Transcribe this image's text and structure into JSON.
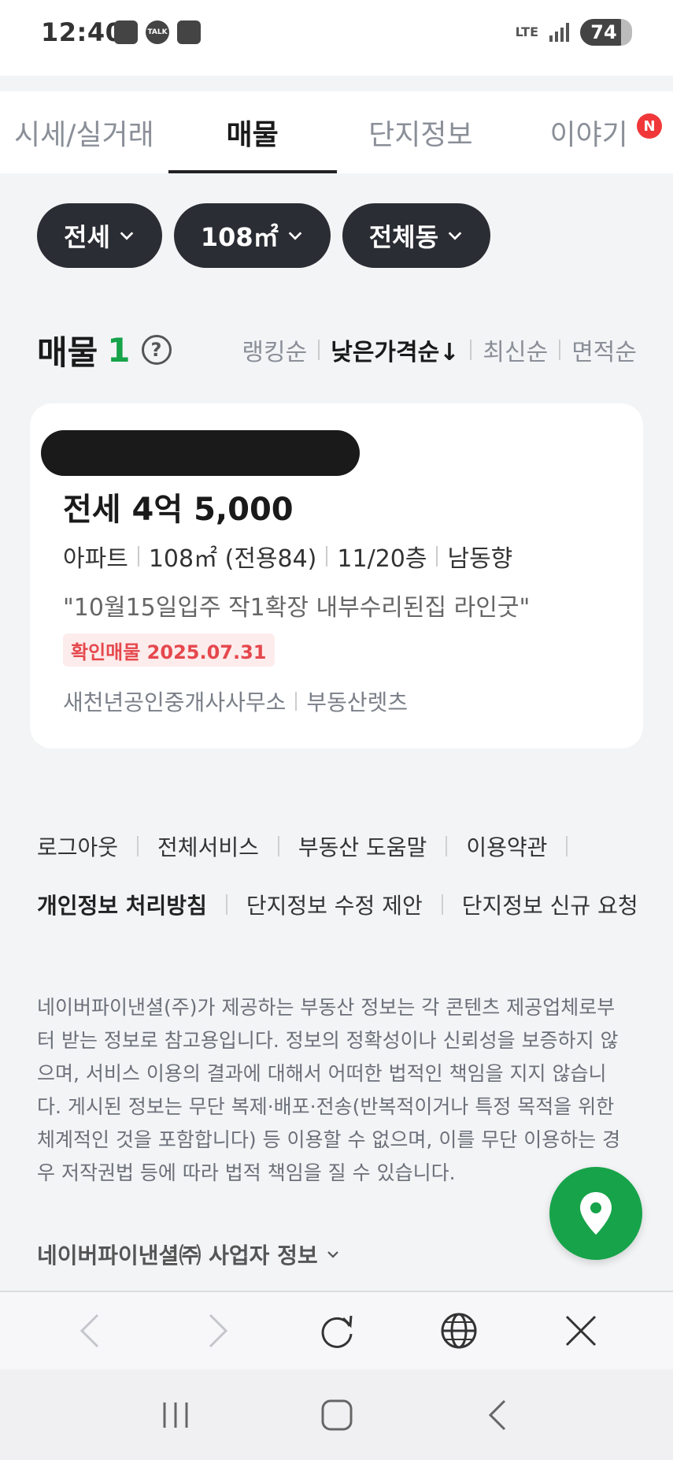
{
  "status_bar": {
    "time": "12:40",
    "network": "LTE",
    "battery": "74",
    "talk_icon": "TALK"
  },
  "tabs": [
    {
      "label": "시세/실거래",
      "active": false
    },
    {
      "label": "매물",
      "active": true
    },
    {
      "label": "단지정보",
      "active": false
    },
    {
      "label": "이야기",
      "active": false,
      "badge": "N"
    }
  ],
  "filters": [
    "전세",
    "108㎡",
    "전체동"
  ],
  "listing_header": {
    "title": "매물",
    "count": "1",
    "help": "?",
    "sorts": [
      {
        "label": "랭킹순",
        "active": false
      },
      {
        "label": "낮은가격순↓",
        "active": true
      },
      {
        "label": "최신순",
        "active": false
      },
      {
        "label": "면적순",
        "active": false
      }
    ]
  },
  "listing": {
    "price": "전세 4억 5,000",
    "specs": [
      "아파트",
      "108㎡ (전용84)",
      "11/20층",
      "남동향"
    ],
    "description": "\"10월15일입주 작1확장 내부수리된집 라인굿\"",
    "badge": "확인매물 2025.07.31",
    "agents": [
      "새천년공인중개사사무소",
      "부동산렛츠"
    ]
  },
  "footer": {
    "links_row1": [
      "로그아웃",
      "전체서비스",
      "부동산 도움말",
      "이용약관"
    ],
    "links_row2": [
      "개인정보 처리방침",
      "단지정보 수정 제안",
      "단지정보 신규 요청"
    ],
    "disclaimer_lines": [
      "네이버파이낸셜(주)가 제공하는 부동산 정보는 각 콘텐츠 제공업체로부",
      "터 받는 정보로 참고용입니다. 정보의 정확성이나 신뢰성을 보증하지 않",
      "으며, 서비스 이용의 결과에 대해서 어떠한 법적인 책임을 지지 않습니",
      "다. 게시된 정보는 무단 복제·배포·전송(반복적이거나 특정 목적을 위한",
      "체계적인 것을 포함합니다) 등 이용할 수 없으며, 이를 무단 이용하는 경",
      "우 저작권법 등에 따라 법적 책임을 질 수 있습니다."
    ],
    "business_info": "네이버파이낸셜㈜ 사업자 정보"
  },
  "colors": {
    "accent_green": "#17a34a",
    "chip_dark": "#2a2d33",
    "badge_red": "#e5484d"
  },
  "icons": {
    "fab": "map-pin-icon",
    "browser": [
      "back-arrow-icon",
      "forward-arrow-icon",
      "refresh-icon",
      "globe-icon",
      "close-icon"
    ],
    "nav": [
      "recent-apps-icon",
      "home-icon",
      "back-icon"
    ]
  }
}
